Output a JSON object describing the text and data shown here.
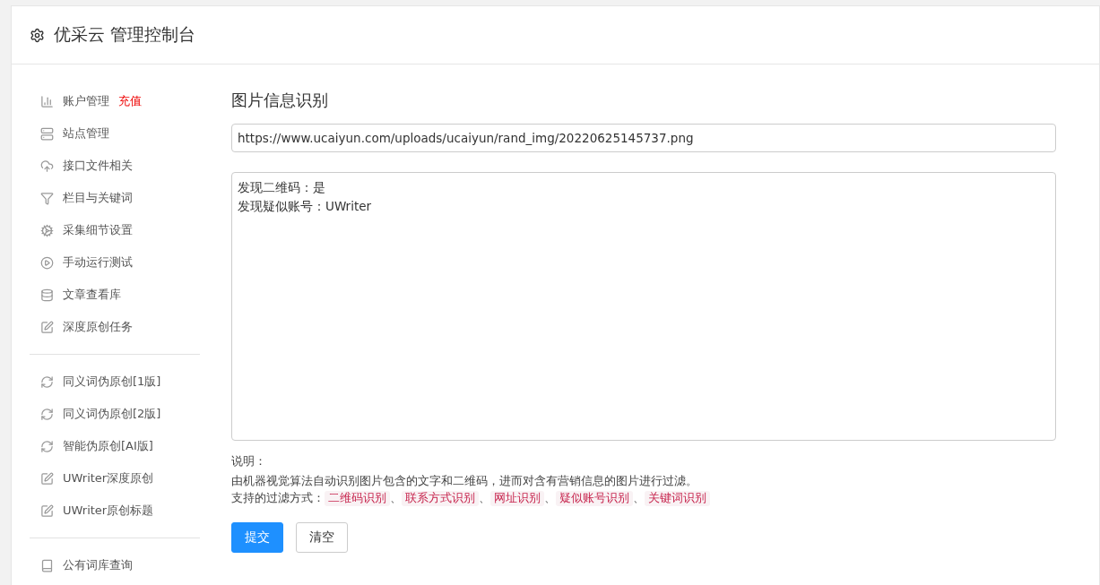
{
  "header": {
    "title": "优采云 管理控制台"
  },
  "sidebar": {
    "groups": [
      {
        "items": [
          {
            "label": "账户管理",
            "badge": "充值"
          },
          {
            "label": "站点管理"
          },
          {
            "label": "接口文件相关"
          },
          {
            "label": "栏目与关键词"
          },
          {
            "label": "采集细节设置"
          },
          {
            "label": "手动运行测试"
          },
          {
            "label": "文章查看库"
          },
          {
            "label": "深度原创任务"
          }
        ]
      },
      {
        "items": [
          {
            "label": "同义词伪原创[1版]"
          },
          {
            "label": "同义词伪原创[2版]"
          },
          {
            "label": "智能伪原创[AI版]"
          },
          {
            "label": "UWriter深度原创"
          },
          {
            "label": "UWriter原创标题"
          }
        ]
      },
      {
        "items": [
          {
            "label": "公有词库查询"
          }
        ]
      }
    ]
  },
  "main": {
    "title": "图片信息识别",
    "url_field": {
      "value": "https://www.ucaiyun.com/uploads/ucaiyun/rand_img/20220625145737.png"
    },
    "result_box": {
      "lines": [
        "发现二维码：是",
        "发现疑似账号：UWriter"
      ]
    },
    "notes": {
      "heading": "说明：",
      "description": "由机器视觉算法自动识别图片包含的文字和二维码，进而对含有营销信息的图片进行过滤。",
      "methods_label": "支持的过滤方式：",
      "separator": "、",
      "methods": [
        "二维码识别",
        "联系方式识别",
        "网址识别",
        "疑似账号识别",
        "关键词识别"
      ]
    },
    "buttons": [
      {
        "label": "提交",
        "kind": "primary"
      },
      {
        "label": "清空",
        "kind": "default"
      }
    ]
  }
}
